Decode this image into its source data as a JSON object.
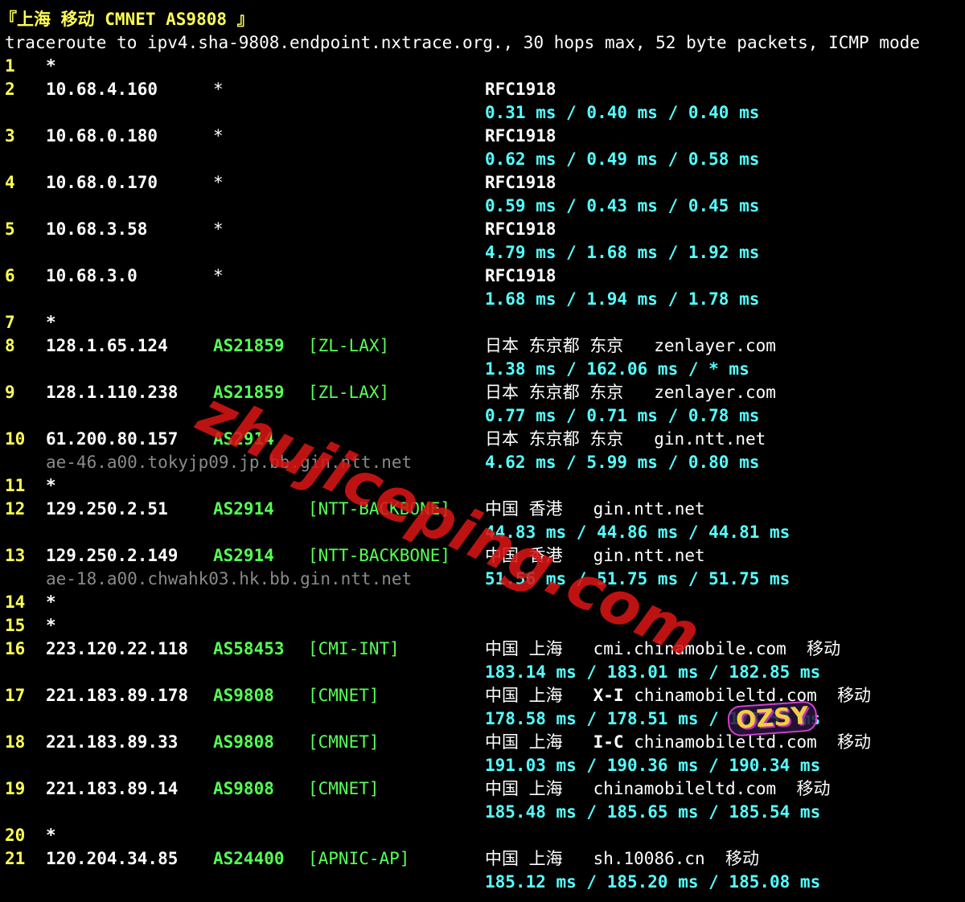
{
  "header": {
    "title": "『上海 移动 CMNET AS9808 』",
    "command": "traceroute to ipv4.sha-9808.endpoint.nxtrace.org., 30 hops max, 52 byte packets, ICMP mode"
  },
  "hops": [
    {
      "n": "1",
      "star": "*"
    },
    {
      "n": "2",
      "ip": "10.68.4.160",
      "asn": "*",
      "geo": "RFC1918",
      "rtt": "0.31 ms / 0.40 ms / 0.40 ms"
    },
    {
      "n": "3",
      "ip": "10.68.0.180",
      "asn": "*",
      "geo": "RFC1918",
      "rtt": "0.62 ms / 0.49 ms / 0.58 ms"
    },
    {
      "n": "4",
      "ip": "10.68.0.170",
      "asn": "*",
      "geo": "RFC1918",
      "rtt": "0.59 ms / 0.43 ms / 0.45 ms"
    },
    {
      "n": "5",
      "ip": "10.68.3.58",
      "asn": "*",
      "geo": "RFC1918",
      "rtt": "4.79 ms / 1.68 ms / 1.92 ms"
    },
    {
      "n": "6",
      "ip": "10.68.3.0",
      "asn": "*",
      "geo": "RFC1918",
      "rtt": "1.68 ms / 1.94 ms / 1.78 ms"
    },
    {
      "n": "7",
      "star": "*"
    },
    {
      "n": "8",
      "ip": "128.1.65.124",
      "asn": "AS21859",
      "tag": "[ZL-LAX]",
      "geo": "日本 东京都 东京",
      "domain": "zenlayer.com",
      "rtt": "1.38 ms / 162.06 ms / * ms"
    },
    {
      "n": "9",
      "ip": "128.1.110.238",
      "asn": "AS21859",
      "tag": "[ZL-LAX]",
      "geo": "日本 东京都 东京",
      "domain": "zenlayer.com",
      "rtt": "0.77 ms / 0.71 ms / 0.78 ms"
    },
    {
      "n": "10",
      "ip": "61.200.80.157",
      "asn": "AS2914",
      "geo": "日本 东京都 东京",
      "domain": "gin.ntt.net",
      "host": "ae-46.a00.tokyjp09.jp.bb.gin.ntt.net",
      "rtt": "4.62 ms / 5.99 ms / 0.80 ms"
    },
    {
      "n": "11",
      "star": "*"
    },
    {
      "n": "12",
      "ip": "129.250.2.51",
      "asn": "AS2914",
      "tag": "[NTT-BACKBONE]",
      "geo": "中国 香港",
      "domain": "gin.ntt.net",
      "rtt": "44.83 ms / 44.86 ms / 44.81 ms"
    },
    {
      "n": "13",
      "ip": "129.250.2.149",
      "asn": "AS2914",
      "tag": "[NTT-BACKBONE]",
      "geo": "中国 香港",
      "domain": "gin.ntt.net",
      "host": "ae-18.a00.chwahk03.hk.bb.gin.ntt.net",
      "rtt": "51.56 ms / 51.75 ms / 51.75 ms"
    },
    {
      "n": "14",
      "star": "*"
    },
    {
      "n": "15",
      "star": "*"
    },
    {
      "n": "16",
      "ip": "223.120.22.118",
      "asn": "AS58453",
      "tag": "[CMI-INT]",
      "geo": "中国 上海",
      "domain": "cmi.chinamobile.com",
      "isp": "移动",
      "rtt": "183.14 ms / 183.01 ms / 182.85 ms"
    },
    {
      "n": "17",
      "ip": "221.183.89.178",
      "asn": "AS9808",
      "tag": "[CMNET]",
      "geo": "中国 上海",
      "link": "X-I",
      "domain": "chinamobileltd.com",
      "isp": "移动",
      "rtt": "178.58 ms / 178.51 ms / 178.53 ms"
    },
    {
      "n": "18",
      "ip": "221.183.89.33",
      "asn": "AS9808",
      "tag": "[CMNET]",
      "geo": "中国 上海",
      "link": "I-C",
      "domain": "chinamobileltd.com",
      "isp": "移动",
      "rtt": "191.03 ms / 190.36 ms / 190.34 ms"
    },
    {
      "n": "19",
      "ip": "221.183.89.14",
      "asn": "AS9808",
      "tag": "[CMNET]",
      "geo": "中国 上海",
      "domain": "chinamobileltd.com",
      "isp": "移动",
      "rtt": "185.48 ms / 185.65 ms / 185.54 ms"
    },
    {
      "n": "20",
      "star": "*"
    },
    {
      "n": "21",
      "ip": "120.204.34.85",
      "asn": "AS24400",
      "tag": "[APNIC-AP]",
      "geo": "中国 上海",
      "domain": "sh.10086.cn",
      "isp": "移动",
      "rtt": "185.12 ms / 185.20 ms / 185.08 ms"
    }
  ],
  "watermark": {
    "text": "zhujiceping.com",
    "badge": "OZSY"
  },
  "colors": {
    "background": "#000000",
    "hop_number": "#ffff55",
    "ip": "#ffffff",
    "asn": "#55ff55",
    "rtt": "#55ffff",
    "hostname": "#8a8a8a",
    "watermark": "#d71414"
  }
}
